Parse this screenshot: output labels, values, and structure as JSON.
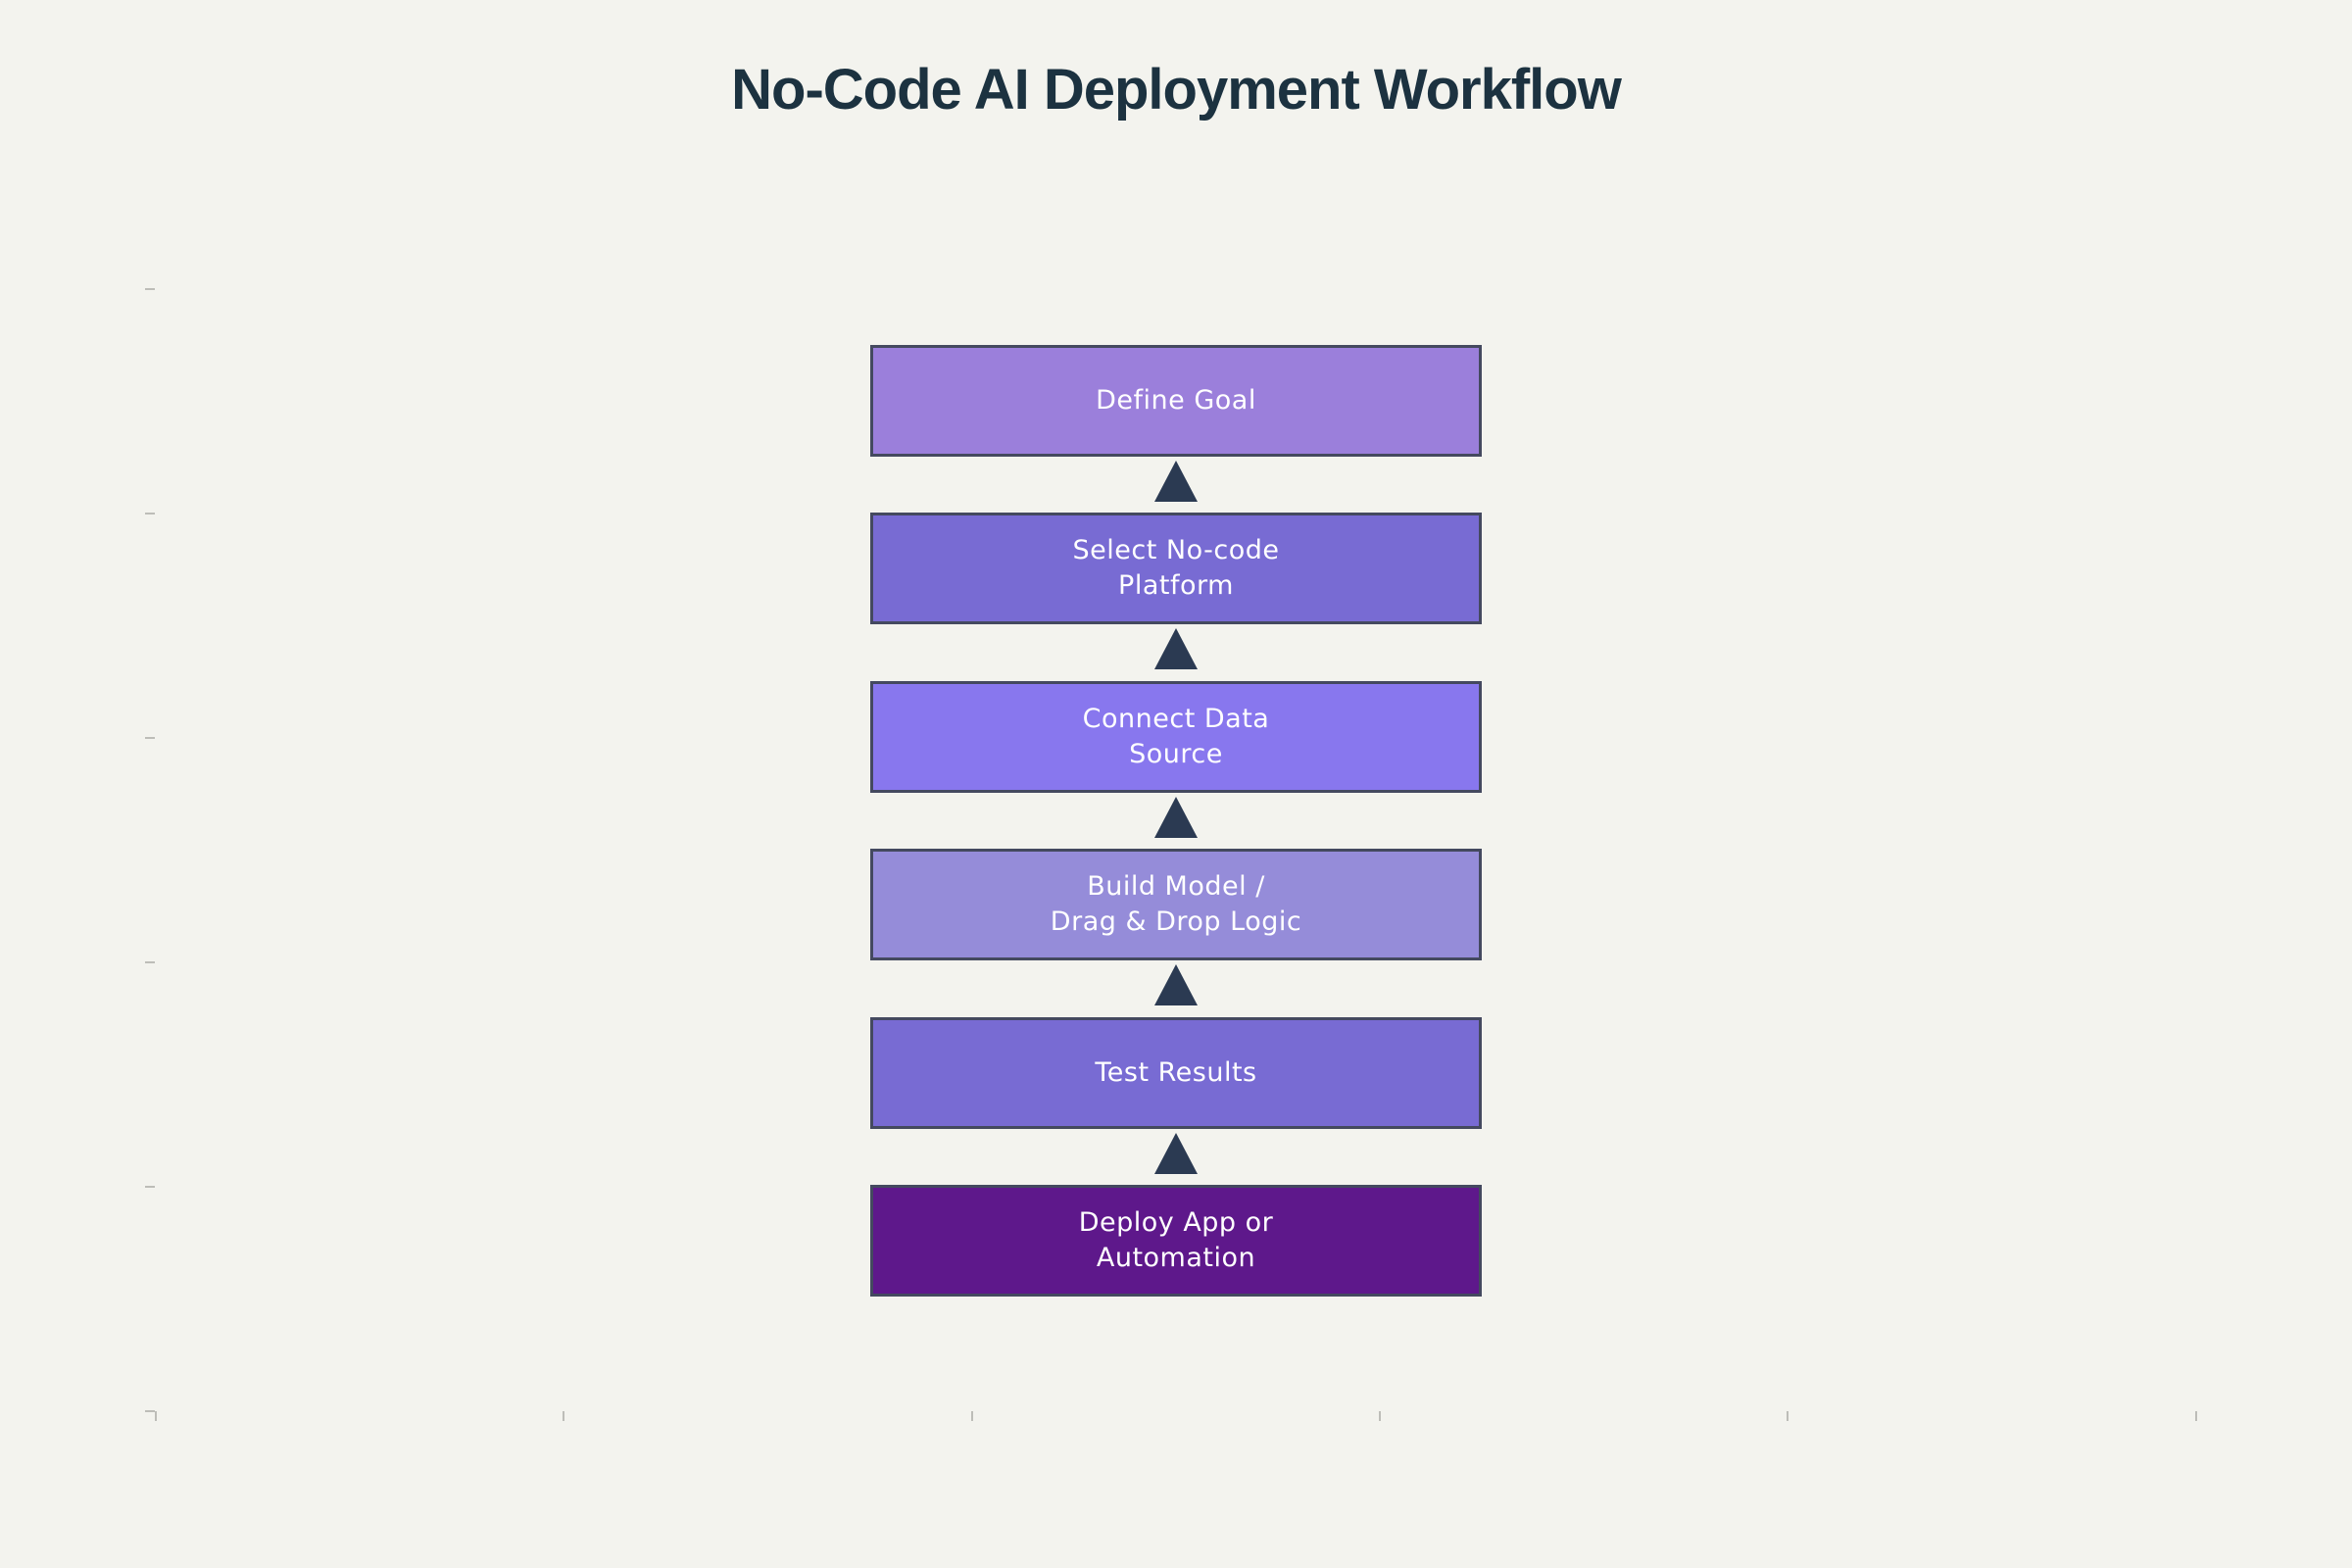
{
  "title": "No-Code AI Deployment Workflow",
  "colors": {
    "background": "#f3f3ee",
    "title": "#1c3240",
    "arrow": "#2b3a52",
    "box_border": "#44495f"
  },
  "steps": [
    {
      "label": "Define Goal",
      "color": "#9b7fdb"
    },
    {
      "label": "Select No-code\nPlatform",
      "color": "#786bd3"
    },
    {
      "label": "Connect Data\nSource",
      "color": "#8877ee"
    },
    {
      "label": "Build Model /\nDrag & Drop Logic",
      "color": "#958cd9"
    },
    {
      "label": "Test Results",
      "color": "#786bd3"
    },
    {
      "label": "Deploy App or\nAutomation",
      "color": "#5e188b"
    }
  ],
  "arrow_direction": "up"
}
